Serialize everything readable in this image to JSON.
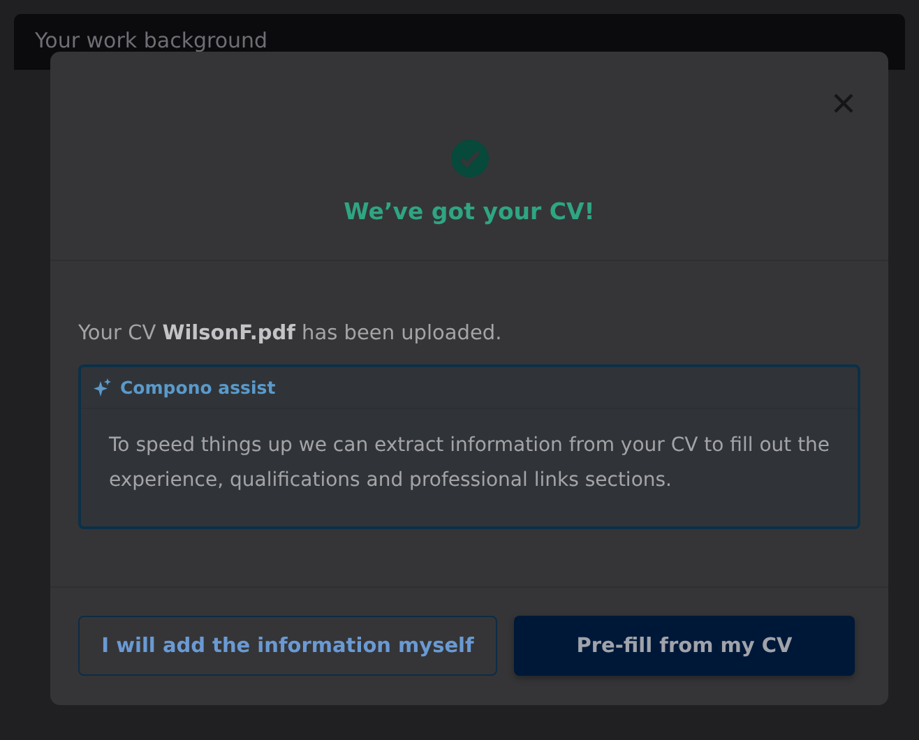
{
  "page": {
    "header": "Your work background"
  },
  "dialog": {
    "title": "We’ve got your CV!",
    "message": "Your CV **WilsonF.pdf** has been uploaded.",
    "assist": {
      "label": "Compono assist",
      "text": "To speed things up we can extract information from your CV to fill out the experience, qualifications and professional links sections."
    },
    "buttons": [
      {
        "label": "I will add the information myself",
        "kind": "secondary"
      },
      {
        "label": "Pre-fill from my CV",
        "kind": "primary"
      }
    ]
  }
}
